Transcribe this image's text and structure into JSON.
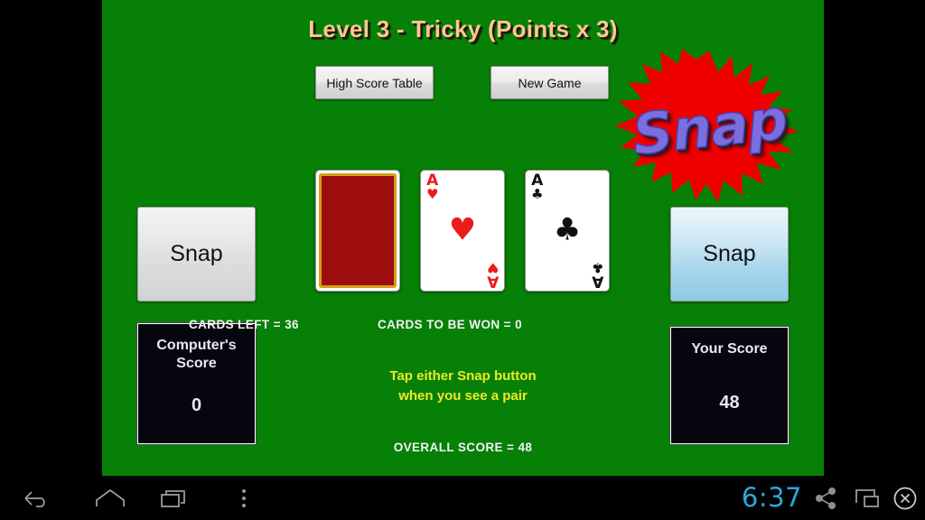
{
  "theme": {
    "table_green": "#078007",
    "title_color": "#f5c896",
    "instruction_yellow": "#ece92a",
    "logo_burst_red": "#ee0000",
    "logo_text_purple": "#7b6fe0",
    "card_back_red": "#9e0d0d",
    "card_back_gold": "#d4a017",
    "panel_black": "#06060f",
    "clock_blue": "#2aa8e0"
  },
  "game": {
    "title": "Level 3 - Tricky (Points x 3)",
    "logo_text": "Snap",
    "logo_icon": "starburst-icon",
    "buttons": {
      "high_score_table": "High Score Table",
      "new_game": "New Game",
      "snap_left": "Snap",
      "snap_right": "Snap"
    },
    "cards": [
      {
        "name": "deck-back",
        "face_up": false,
        "rank": "",
        "suit": "",
        "suit_symbol": "",
        "color": ""
      },
      {
        "name": "computer-card",
        "face_up": true,
        "rank": "A",
        "suit": "hearts",
        "suit_symbol": "♥",
        "color": "red"
      },
      {
        "name": "player-card",
        "face_up": true,
        "rank": "A",
        "suit": "clubs",
        "suit_symbol": "♣",
        "color": "black"
      }
    ],
    "scores": {
      "computer_label_line1": "Computer's",
      "computer_label_line2": "Score",
      "computer_value": "0",
      "player_label": "Your Score",
      "player_value": "48"
    },
    "status": {
      "cards_left": "CARDS LEFT = 36",
      "cards_to_be_won": "CARDS TO BE WON = 0",
      "overall_score": "OVERALL SCORE = 48"
    },
    "instruction_line1": "Tap either Snap button",
    "instruction_line2": "when you see a pair"
  },
  "system_bar": {
    "clock": "6:37",
    "icons": {
      "back": "back-arrow-icon",
      "home": "home-icon",
      "recent": "recent-apps-icon",
      "menu": "overflow-menu-icon",
      "share": "share-icon",
      "window": "window-resize-icon",
      "close": "close-circle-icon"
    }
  }
}
